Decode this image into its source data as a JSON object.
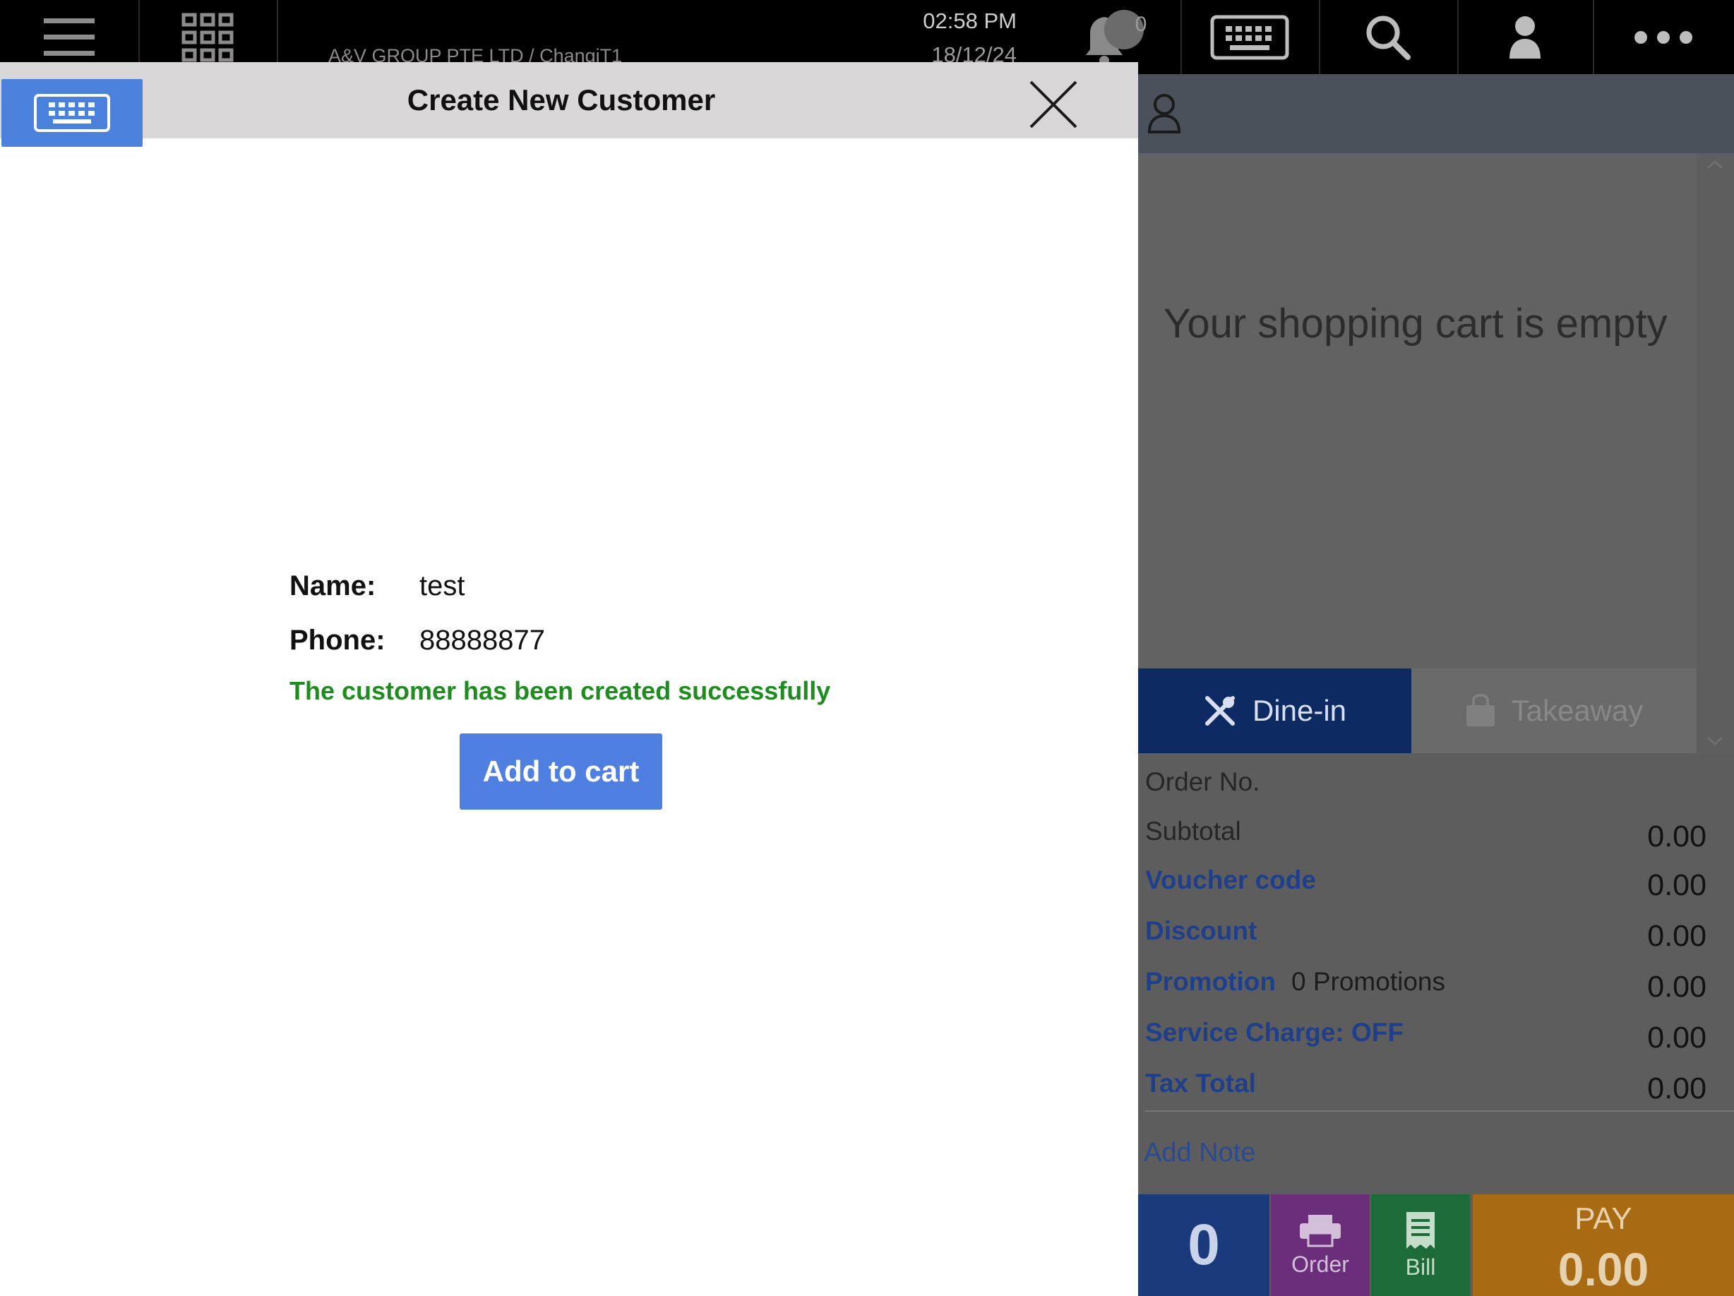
{
  "topbar": {
    "org": "A&V GROUP PTE LTD / ChangiT1",
    "time": "02:58 PM",
    "date": "18/12/24",
    "notification_count": "0"
  },
  "modal": {
    "title": "Create New Customer",
    "name_label": "Name:",
    "name_value": "test",
    "phone_label": "Phone:",
    "phone_value": "88888877",
    "success_message": "The customer has been created successfully",
    "add_to_cart_label": "Add to cart"
  },
  "cart": {
    "empty_text": "Your shopping cart is empty",
    "dine_in_label": "Dine-in",
    "takeaway_label": "Takeaway",
    "order_no_label": "Order No.",
    "rows": [
      {
        "label": "Subtotal",
        "value": "0.00"
      },
      {
        "label": "Voucher code",
        "value": "0.00"
      },
      {
        "label": "Discount",
        "value": "0.00"
      },
      {
        "label": "Promotion",
        "extra": "0 Promotions",
        "value": "0.00"
      },
      {
        "label": "Service Charge: OFF",
        "value": "0.00"
      },
      {
        "label": "Tax Total",
        "value": "0.00"
      }
    ],
    "add_note_label": "Add Note",
    "item_count": "0",
    "order_label": "Order",
    "bill_label": "Bill",
    "pay_label": "PAY",
    "pay_value": "0.00"
  },
  "colors": {
    "accent_blue": "#4f80e1",
    "success_green": "#1e8c1e",
    "dine_in_bg": "#0e2a63",
    "pay_bg": "#a86a12"
  }
}
